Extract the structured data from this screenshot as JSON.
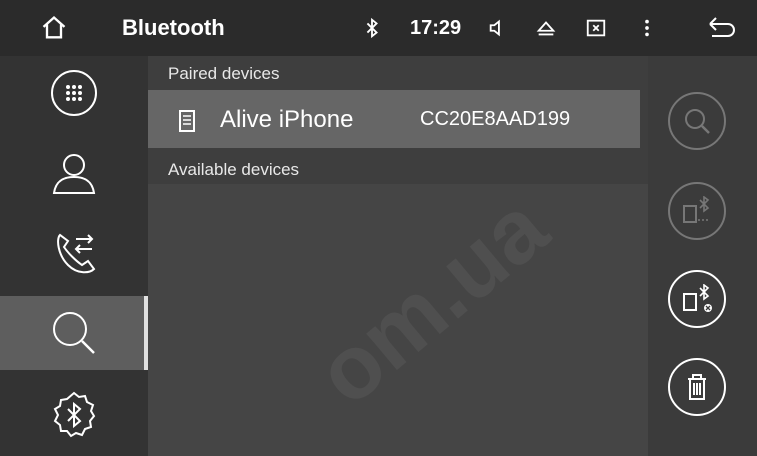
{
  "header": {
    "title": "Bluetooth",
    "time": "17:29",
    "icons": [
      "home-icon",
      "bluetooth-status-icon",
      "volume-icon",
      "eject-icon",
      "screen-off-icon",
      "more-icon",
      "back-icon"
    ]
  },
  "sidebar": {
    "items": [
      {
        "name": "dialpad",
        "icon": "dialpad-icon"
      },
      {
        "name": "contacts",
        "icon": "contact-icon"
      },
      {
        "name": "call-log",
        "icon": "call-log-icon"
      },
      {
        "name": "search",
        "icon": "search-icon",
        "active": true
      },
      {
        "name": "settings",
        "icon": "bluetooth-settings-icon"
      }
    ]
  },
  "main": {
    "paired_label": "Paired devices",
    "paired_devices": [
      {
        "name": "Alive iPhone",
        "address": "CC20E8AAD199",
        "icon": "phone-icon"
      }
    ],
    "available_label": "Available devices"
  },
  "rightbar": {
    "buttons": [
      {
        "name": "search",
        "icon": "search-icon",
        "enabled": false
      },
      {
        "name": "connect",
        "icon": "connect-device-icon",
        "enabled": false
      },
      {
        "name": "disconnect",
        "icon": "disconnect-device-icon",
        "enabled": true
      },
      {
        "name": "delete",
        "icon": "trash-icon",
        "enabled": true
      }
    ]
  },
  "watermark": "om.ua",
  "colors": {
    "header_bg": "#2b2b2b",
    "sidebar_bg": "#333333",
    "main_bg": "#3e3e3e",
    "paired_row_bg": "#666666",
    "active_nav_bg": "#5e5e5e"
  }
}
